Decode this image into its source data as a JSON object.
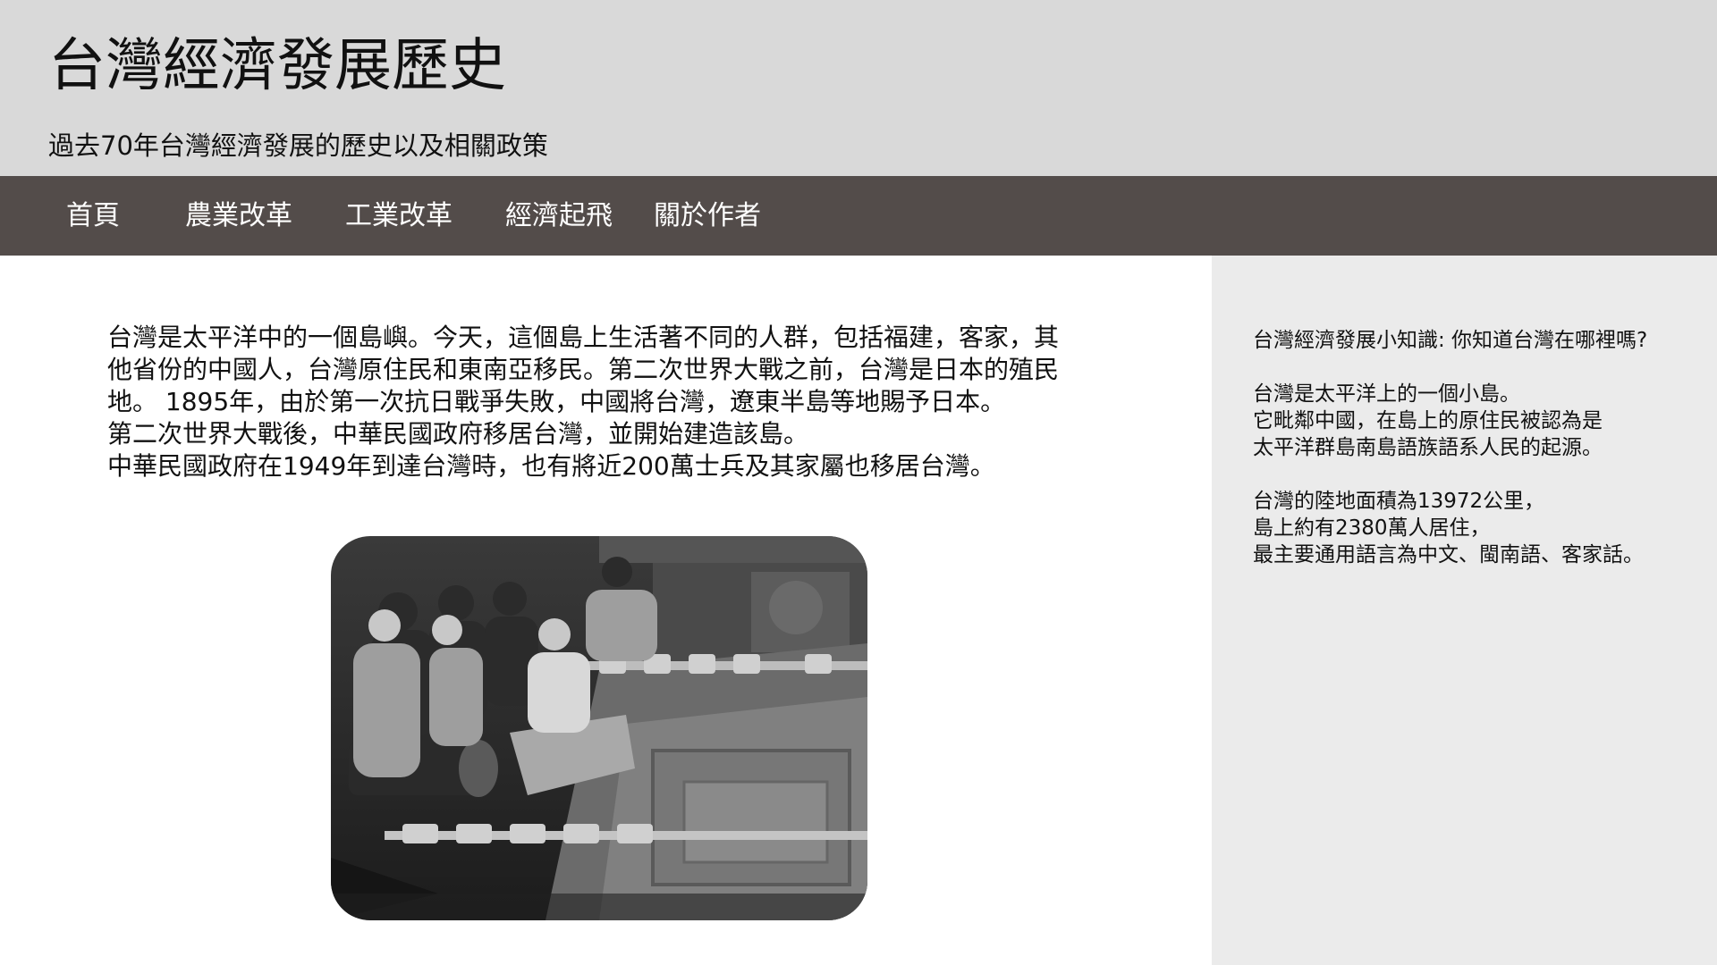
{
  "header": {
    "title": "台灣經濟發展歷史",
    "subtitle": "過去70年台灣經濟發展的歷史以及相關政策"
  },
  "nav": {
    "items": [
      {
        "label": "首頁"
      },
      {
        "label": "農業改革"
      },
      {
        "label": "工業改革"
      },
      {
        "label": "經濟起飛"
      },
      {
        "label": "關於作者"
      }
    ]
  },
  "main": {
    "paragraph_lines": [
      "台灣是太平洋中的一個島嶼。今天，這個島上生活著不同的人群，包括福建，客家，其",
      "他省份的中國人，台灣原住民和東南亞移民。第二次世界大戰之前，台灣是日本的殖民",
      "地。 1895年，由於第一次抗日戰爭失敗，中國將台灣，遼東半島等地賜予日本。",
      "第二次世界大戰後，中華民國政府移居台灣，並開始建造該島。",
      "中華民國政府在1949年到達台灣時，也有將近200萬士兵及其家屬也移居台灣。"
    ]
  },
  "sidebar": {
    "heading": "台灣經濟發展小知識: 你知道台灣在哪裡嗎?",
    "block1": [
      "台灣是太平洋上的一個小島。",
      "它毗鄰中國，在島上的原住民被認為是",
      "太平洋群島南島語族語系人民的起源。"
    ],
    "block2": [
      "台灣的陸地面積為13972公里，",
      "島上約有2380萬人居住，",
      "最主要通用語言為中文、閩南語、客家話。"
    ]
  },
  "colors": {
    "header_bg": "#d9d9d9",
    "nav_bg": "#534c4a",
    "sidebar_bg": "#ebebeb"
  }
}
